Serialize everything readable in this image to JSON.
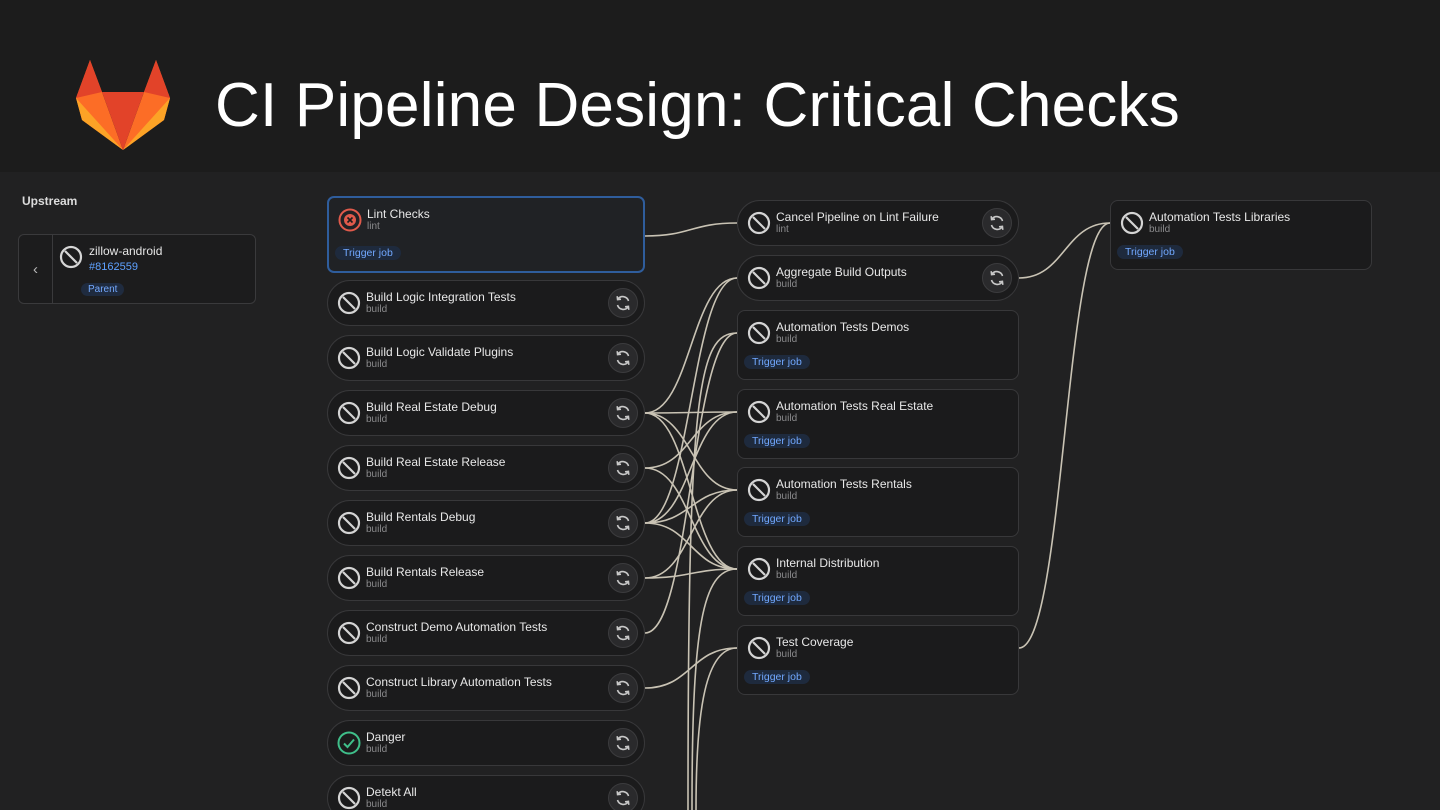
{
  "header": {
    "title": "CI Pipeline Design: Critical Checks"
  },
  "colors": {
    "link": "#c9c3b4",
    "accent": "#5ea1ff",
    "failed": "#e05a4b",
    "success": "#3fbf8a"
  },
  "upstream": {
    "label": "Upstream",
    "project": "zillow-android",
    "pipeline": "#8162559",
    "badge": "Parent"
  },
  "trigger_label": "Trigger job",
  "jobs_col1": [
    {
      "name": "Lint Checks",
      "stage": "lint",
      "status": "failed",
      "trigger": true
    },
    {
      "name": "Build Logic Integration Tests",
      "stage": "build",
      "status": "skipped",
      "retry": true
    },
    {
      "name": "Build Logic Validate Plugins",
      "stage": "build",
      "status": "skipped",
      "retry": true
    },
    {
      "name": "Build Real Estate Debug",
      "stage": "build",
      "status": "skipped",
      "retry": true
    },
    {
      "name": "Build Real Estate Release",
      "stage": "build",
      "status": "skipped",
      "retry": true
    },
    {
      "name": "Build Rentals Debug",
      "stage": "build",
      "status": "skipped",
      "retry": true
    },
    {
      "name": "Build Rentals Release",
      "stage": "build",
      "status": "skipped",
      "retry": true
    },
    {
      "name": "Construct Demo Automation Tests",
      "stage": "build",
      "status": "skipped",
      "retry": true
    },
    {
      "name": "Construct Library Automation Tests",
      "stage": "build",
      "status": "skipped",
      "retry": true
    },
    {
      "name": "Danger",
      "stage": "build",
      "status": "success",
      "retry": true
    },
    {
      "name": "Detekt All",
      "stage": "build",
      "status": "skipped",
      "retry": true
    }
  ],
  "jobs_col2": [
    {
      "name": "Cancel Pipeline on Lint Failure",
      "stage": "lint",
      "status": "skipped",
      "retry": true
    },
    {
      "name": "Aggregate Build Outputs",
      "stage": "build",
      "status": "skipped",
      "retry": true
    },
    {
      "name": "Automation Tests Demos",
      "stage": "build",
      "status": "skipped",
      "trigger": true
    },
    {
      "name": "Automation Tests Real Estate",
      "stage": "build",
      "status": "skipped",
      "trigger": true
    },
    {
      "name": "Automation Tests Rentals",
      "stage": "build",
      "status": "skipped",
      "trigger": true
    },
    {
      "name": "Internal Distribution",
      "stage": "build",
      "status": "skipped",
      "trigger": true
    },
    {
      "name": "Test Coverage",
      "stage": "build",
      "status": "skipped",
      "trigger": true
    }
  ],
  "jobs_col3": [
    {
      "name": "Automation Tests Libraries",
      "stage": "build",
      "status": "skipped",
      "trigger": true
    }
  ]
}
